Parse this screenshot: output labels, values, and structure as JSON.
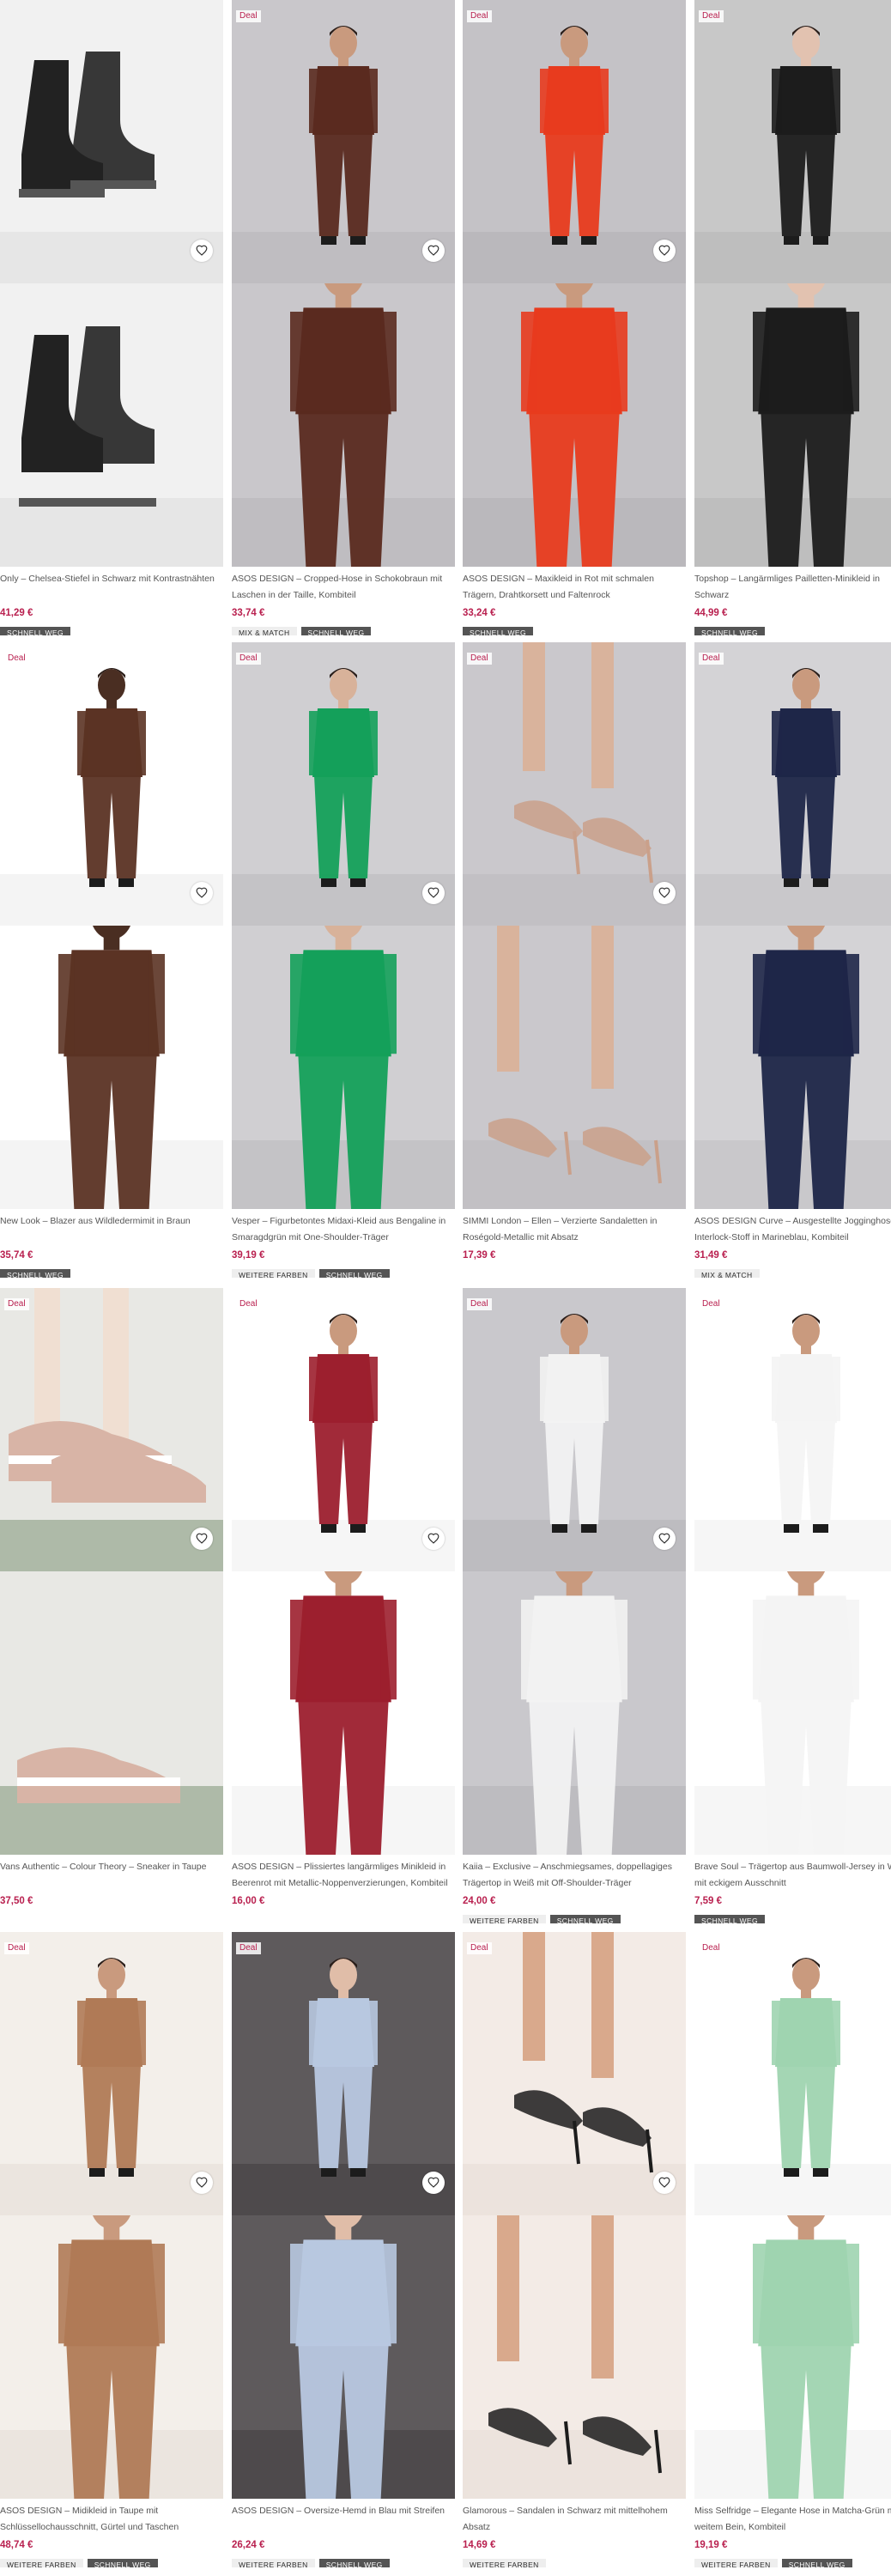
{
  "products": [
    {
      "deal": "",
      "title": "Only – Chelsea-Stiefel in Schwarz mit Kontrastnähten",
      "price": "41,29 €",
      "tags": [
        {
          "text": "SCHNELL WEG",
          "style": "dark"
        }
      ],
      "palette": {
        "bg": "#f1f1f1",
        "item": "#222222",
        "skin": "#222222",
        "floor": "#e6e6e6"
      },
      "kind": "boots"
    },
    {
      "deal": "Deal",
      "title": "ASOS DESIGN – Cropped-Hose in Schokobraun mit Laschen in der Taille, Kombiteil",
      "price": "33,74 €",
      "tags": [
        {
          "text": "MIX & MATCH",
          "style": "light"
        },
        {
          "text": "SCHNELL WEG",
          "style": "dark"
        }
      ],
      "palette": {
        "bg": "#c9c7cb",
        "item": "#5a2a1f",
        "skin": "#c99a7e",
        "floor": "#bfbdc1"
      },
      "kind": "model"
    },
    {
      "deal": "Deal",
      "title": "ASOS DESIGN – Maxikleid in Rot mit schmalen Trägern, Drahtkorsett und Faltenrock",
      "price": "33,24 €",
      "tags": [
        {
          "text": "SCHNELL WEG",
          "style": "dark"
        }
      ],
      "palette": {
        "bg": "#c4c2c6",
        "item": "#e83b1e",
        "skin": "#c99a7e",
        "floor": "#bab8bc"
      },
      "kind": "model"
    },
    {
      "deal": "Deal",
      "title": "Topshop – Langärmliges Pailletten-Minikleid in Schwarz",
      "price": "44,99 €",
      "tags": [
        {
          "text": "SCHNELL WEG",
          "style": "dark"
        }
      ],
      "palette": {
        "bg": "#c8c8c8",
        "item": "#1c1c1c",
        "skin": "#e2c2b0",
        "floor": "#bebebe"
      },
      "kind": "model"
    },
    {
      "deal": "Deal",
      "title": "New Look – Blazer aus Wildledermimit in Braun",
      "price": "35,74 €",
      "tags": [
        {
          "text": "SCHNELL WEG",
          "style": "dark"
        }
      ],
      "palette": {
        "bg": "#ffffff",
        "item": "#5b3324",
        "skin": "#4a2e22",
        "floor": "#f4f4f4"
      },
      "kind": "model"
    },
    {
      "deal": "Deal",
      "title": "Vesper – Figurbetontes Midaxi-Kleid aus Bengaline in Smaragdgrün mit One-Shoulder-Träger",
      "price": "39,19 €",
      "tags": [
        {
          "text": "WEITERE FARBEN",
          "style": "light"
        },
        {
          "text": "SCHNELL WEG",
          "style": "dark"
        }
      ],
      "palette": {
        "bg": "#d0cfd2",
        "item": "#14a05a",
        "skin": "#d8b29a",
        "floor": "#c4c3c6"
      },
      "kind": "model"
    },
    {
      "deal": "Deal",
      "title": "SIMMI London – Ellen – Verzierte Sandaletten in Roségold-Metallic mit Absatz",
      "price": "17,39 €",
      "tags": [],
      "palette": {
        "bg": "#cac8cc",
        "item": "#caa08a",
        "skin": "#d9b39c",
        "floor": "#c2c0c4"
      },
      "kind": "sandals"
    },
    {
      "deal": "Deal",
      "title": "ASOS DESIGN Curve – Ausgestellte Jogginghose aus Interlock-Stoff in Marineblau, Kombiteil",
      "price": "31,49 €",
      "tags": [
        {
          "text": "MIX & MATCH",
          "style": "light"
        }
      ],
      "palette": {
        "bg": "#d4d3d6",
        "item": "#1e2648",
        "skin": "#c99a7e",
        "floor": "#c9c8cb"
      },
      "kind": "model"
    },
    {
      "deal": "Deal",
      "title": "Vans Authentic – Colour Theory – Sneaker in Taupe",
      "price": "37,50 €",
      "tags": [],
      "palette": {
        "bg": "#e8e8e4",
        "item": "#d8b4a6",
        "skin": "#f0dfd2",
        "floor": "#aebaa8"
      },
      "kind": "sneakers"
    },
    {
      "deal": "Deal",
      "title": "ASOS DESIGN – Plissiertes langärmliges Minikleid in Beerenrot mit Metallic-Noppenverzierungen, Kombiteil",
      "price": "16,00 €",
      "tags": [],
      "palette": {
        "bg": "#ffffff",
        "item": "#9c1f2e",
        "skin": "#c99a7e",
        "floor": "#f6f6f6"
      },
      "kind": "model"
    },
    {
      "deal": "Deal",
      "title": "Kaiia – Exclusive – Anschmiegsames, doppellagiges Trägertop in Weiß mit Off-Shoulder-Träger",
      "price": "24,00 €",
      "tags": [
        {
          "text": "WEITERE FARBEN",
          "style": "light"
        },
        {
          "text": "SCHNELL WEG",
          "style": "dark"
        }
      ],
      "palette": {
        "bg": "#c9c8cc",
        "item": "#f2f2f2",
        "skin": "#c99a7e",
        "floor": "#bdbcc0"
      },
      "kind": "model"
    },
    {
      "deal": "Deal",
      "title": "Brave Soul – Trägertop aus Baumwoll-Jersey in Weiß mit eckigem Ausschnitt",
      "price": "7,59 €",
      "tags": [
        {
          "text": "SCHNELL WEG",
          "style": "dark"
        }
      ],
      "palette": {
        "bg": "#ffffff",
        "item": "#f4f4f4",
        "skin": "#c99a7e",
        "floor": "#f6f6f6"
      },
      "kind": "model"
    },
    {
      "deal": "Deal",
      "title": "ASOS DESIGN – Midikleid in Taupe mit Schlüssellochausschnitt, Gürtel und Taschen",
      "price": "48,74 €",
      "tags": [
        {
          "text": "WEITERE FARBEN",
          "style": "light"
        },
        {
          "text": "SCHNELL WEG",
          "style": "dark"
        }
      ],
      "palette": {
        "bg": "#f3efea",
        "item": "#b07a56",
        "skin": "#c99a7e",
        "floor": "#ebe5df"
      },
      "kind": "model"
    },
    {
      "deal": "Deal",
      "title": "ASOS DESIGN – Oversize-Hemd in Blau mit Streifen",
      "price": "26,24 €",
      "tags": [
        {
          "text": "WEITERE FARBEN",
          "style": "light"
        },
        {
          "text": "SCHNELL WEG",
          "style": "dark"
        }
      ],
      "palette": {
        "bg": "#5e5a5c",
        "item": "#b8c8e0",
        "skin": "#e0bda8",
        "floor": "#4e4a4c"
      },
      "kind": "model"
    },
    {
      "deal": "Deal",
      "title": "Glamorous – Sandalen in Schwarz mit mittelhohem Absatz",
      "price": "14,69 €",
      "tags": [
        {
          "text": "WEITERE FARBEN",
          "style": "light"
        }
      ],
      "palette": {
        "bg": "#f3ebe6",
        "item": "#1c1c1c",
        "skin": "#d9a98c",
        "floor": "#ece3dd"
      },
      "kind": "sandals"
    },
    {
      "deal": "Deal",
      "title": "Miss Selfridge – Elegante Hose in Matcha-Grün mit weitem Bein, Kombiteil",
      "price": "19,19 €",
      "tags": [
        {
          "text": "WEITERE FARBEN",
          "style": "light"
        },
        {
          "text": "SCHNELL WEG",
          "style": "dark"
        }
      ],
      "palette": {
        "bg": "#ffffff",
        "item": "#9fd4b0",
        "skin": "#c99a7e",
        "floor": "#f6f6f6"
      },
      "kind": "model"
    }
  ]
}
